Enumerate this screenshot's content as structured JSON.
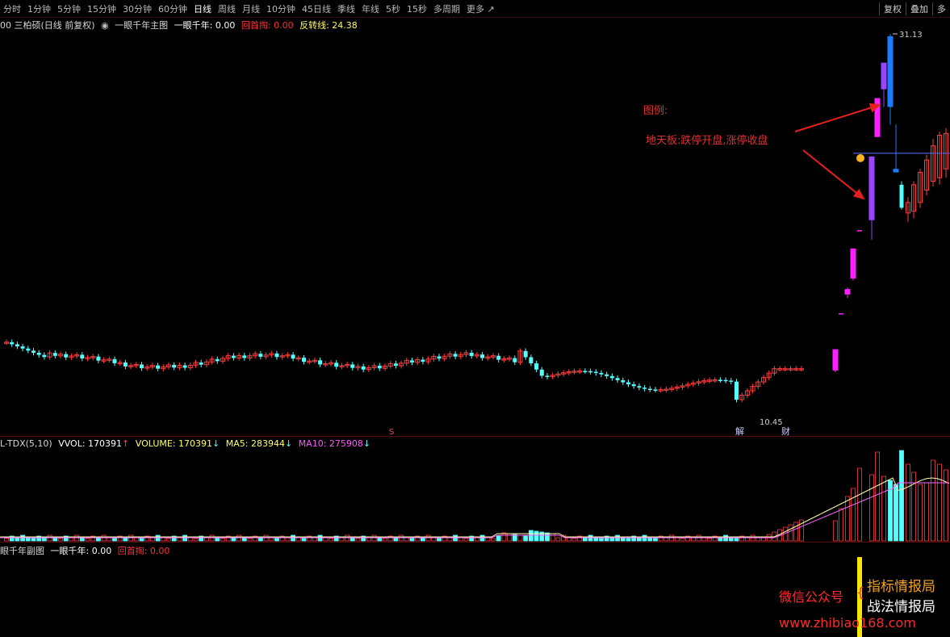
{
  "toolbar": {
    "periods": [
      "分时",
      "1分钟",
      "5分钟",
      "15分钟",
      "30分钟",
      "60分钟",
      "日线",
      "周线",
      "月线",
      "10分钟",
      "45日线",
      "季线",
      "年线",
      "5秒",
      "15秒",
      "多周期",
      "更多 ↗"
    ],
    "active_period": "日线",
    "right_buttons": [
      "复权",
      "叠加",
      "多"
    ]
  },
  "main_info": {
    "stock": "00 三柏硕(日线 前复权)",
    "indicator_name": "一眼千年主图",
    "yiyan_label": "一眼千年: 0.00",
    "huishou_label": "回首掏: 0.00",
    "fanzhuan_label": "反转线: 24.38"
  },
  "volume_info": {
    "name": "L-TDX(5,10)",
    "vvol": "VVOL: 170391",
    "volume": "VOLUME: 170391",
    "ma5": "MA5: 283944",
    "ma10": "MA10: 275908"
  },
  "sub_info": {
    "name": "眼千年副图",
    "yiyan_label": "一眼千年: 0.00",
    "huishou_label": "回首掏: 0.00"
  },
  "annotations": {
    "legend_title": "图例:",
    "legend_text": "地天板:跌停开盘,涨停收盘",
    "high_price": "31.13",
    "low_price": "10.45",
    "marker_jie": "解",
    "marker_cai": "财",
    "marker_s": "S"
  },
  "watermark": {
    "label": "微信公众号",
    "line1": "指标情报局",
    "line2": "战法情报局",
    "url": "www.zhibiao168.com"
  },
  "colors": {
    "up": "#ff3d3d",
    "down": "#54ffff",
    "limit_up": "#ff20ff",
    "ditianban": "#9944ff",
    "blue_bar": "#1a7cff",
    "fanzhuan_line": "#5577ff",
    "arrow": "#e62020"
  },
  "chart_data": {
    "type": "candlestick",
    "y_range": [
      10.0,
      32.0
    ],
    "highlighted_high": 31.13,
    "highlighted_low": 10.45,
    "fanzhuan_level": 24.38,
    "volume_ma": [
      "MA5",
      "MA10"
    ]
  }
}
